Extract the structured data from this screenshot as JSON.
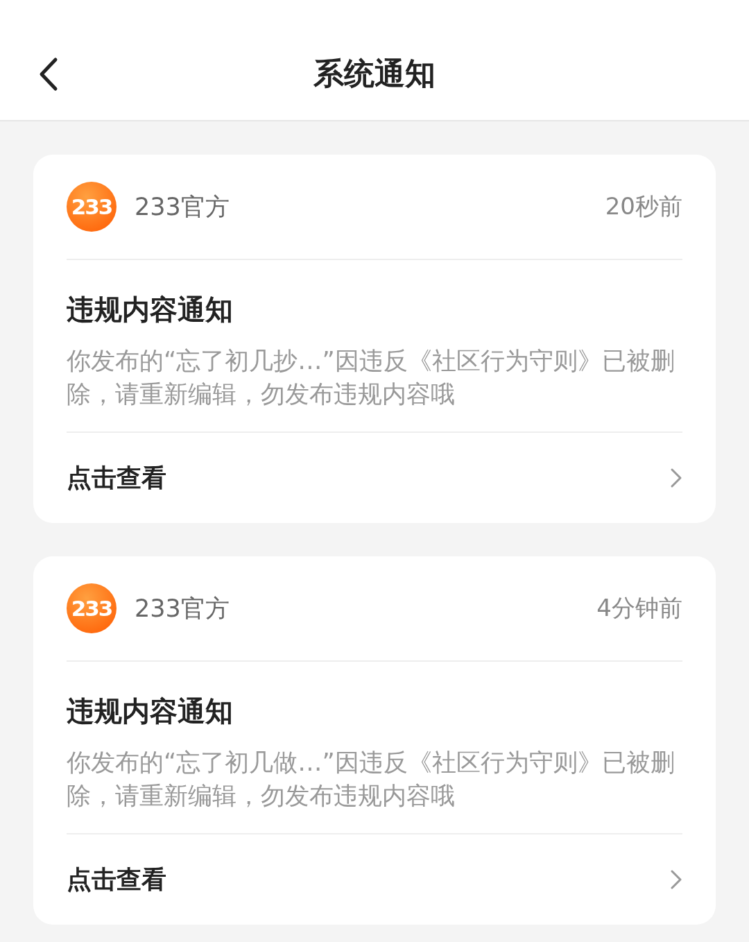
{
  "header": {
    "title": "系统通知"
  },
  "notifications": [
    {
      "logo_text": "233",
      "sender": "233官方",
      "time": "20秒前",
      "title": "违规内容通知",
      "body": "你发布的“忘了初几抄…”因违反《社区行为守则》已被删除，请重新编辑，勿发布违规内容哦",
      "link": "点击查看"
    },
    {
      "logo_text": "233",
      "sender": "233官方",
      "time": "4分钟前",
      "title": "违规内容通知",
      "body": "你发布的“忘了初几做…”因违反《社区行为守则》已被删除，请重新编辑，勿发布违规内容哦",
      "link": "点击查看"
    }
  ]
}
